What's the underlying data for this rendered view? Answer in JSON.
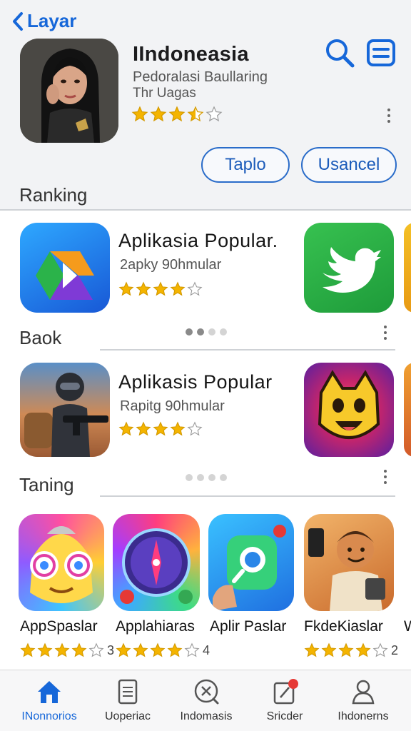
{
  "header": {
    "back_label": "Layar",
    "app_title": "IIndoneasia",
    "subtitle_1": "Pedoralasi Baullaring",
    "subtitle_2": "Thr Uagas",
    "rating": 3.5,
    "btn_primary": "Taplo",
    "btn_secondary": "Usancel"
  },
  "sections": {
    "ranking": "Ranking",
    "baok": "Baok",
    "taning": "Taning"
  },
  "rows": [
    {
      "title": "Aplikasia  Popular.",
      "subtitle": "2apky 90hmular",
      "rating": 4,
      "pager_active": 0
    },
    {
      "title": "Aplikasis Popular",
      "subtitle": "Rapitg 90hmular",
      "rating": 4,
      "pager_active": -1
    }
  ],
  "grid": [
    {
      "name": "AppSpaslar",
      "rating": 4,
      "count": "3"
    },
    {
      "name": "Applahiaras",
      "rating": 4,
      "count": "4"
    },
    {
      "name": "Aplir Paslar",
      "rating": 0,
      "count": ""
    },
    {
      "name": "FkdeKiaslar",
      "rating": 4,
      "count": "2"
    }
  ],
  "tabs": [
    {
      "label": "INonnorios",
      "icon": "home-icon",
      "active": true
    },
    {
      "label": "Uoperiac",
      "icon": "document-icon",
      "active": false
    },
    {
      "label": "Indomasis",
      "icon": "search-x-icon",
      "active": false
    },
    {
      "label": "Sricder",
      "icon": "notepad-badge-icon",
      "active": false
    },
    {
      "label": "Ihdonerns",
      "icon": "person-icon",
      "active": false
    }
  ],
  "colors": {
    "accent": "#1667d9",
    "star": "#f4b400"
  }
}
